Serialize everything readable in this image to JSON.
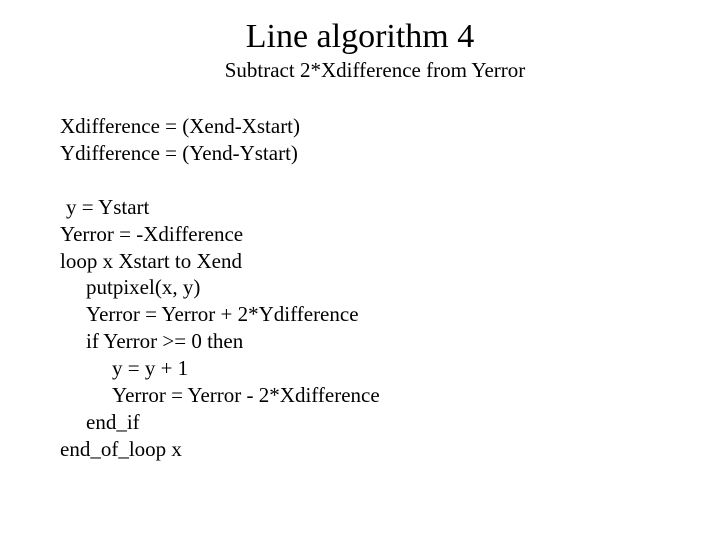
{
  "title": "Line algorithm 4",
  "subtitle": "Subtract 2*Xdifference from Yerror",
  "lines": {
    "l0": "Xdifference = (Xend-Xstart)",
    "l1": "Ydifference = (Yend-Ystart)",
    "l2": " y = Ystart",
    "l3": "Yerror = -Xdifference",
    "l4": "loop x Xstart to Xend",
    "l5": "putpixel(x, y)",
    "l6": "Yerror = Yerror + 2*Ydifference",
    "l7": "if Yerror >= 0 then",
    "l8": "y = y + 1",
    "l9": "Yerror = Yerror - 2*Xdifference",
    "l10": "end_if",
    "l11": "end_of_loop x"
  }
}
